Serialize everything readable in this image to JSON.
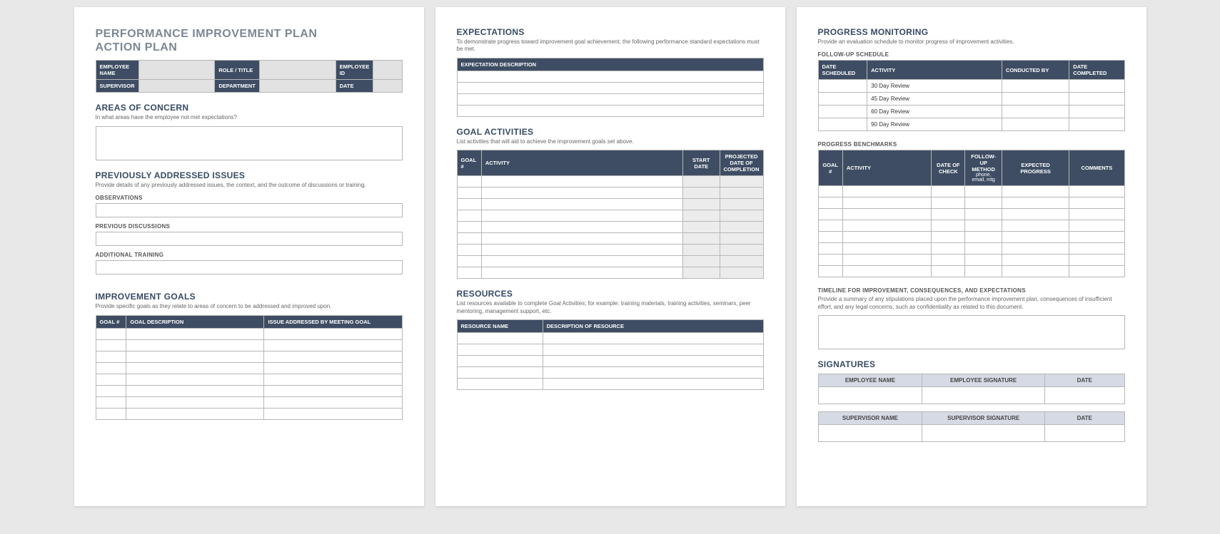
{
  "page1": {
    "title_line1": "PERFORMANCE IMPROVEMENT PLAN",
    "title_line2": "ACTION PLAN",
    "info_labels": {
      "employee_name": "EMPLOYEE NAME",
      "role_title": "ROLE / TITLE",
      "employee_id": "EMPLOYEE ID",
      "supervisor": "SUPERVISOR",
      "department": "DEPARTMENT",
      "date": "DATE"
    },
    "areas_of_concern": {
      "heading": "AREAS OF CONCERN",
      "sub": "In what areas have the employee not met expectations?"
    },
    "previously_addressed": {
      "heading": "PREVIOUSLY ADDRESSED ISSUES",
      "sub": "Provide details of any previously addressed issues, the context, and the outcome of discussions or training.",
      "observations": "OBSERVATIONS",
      "previous_discussions": "PREVIOUS DISCUSSIONS",
      "additional_training": "ADDITIONAL TRAINING"
    },
    "improvement_goals": {
      "heading": "IMPROVEMENT GOALS",
      "sub": "Provide specific goals as they relate to areas of concern to be addressed and improved upon.",
      "cols": {
        "goal_num": "GOAL #",
        "goal_desc": "GOAL DESCRIPTION",
        "issue": "ISSUE ADDRESSED BY MEETING GOAL"
      }
    }
  },
  "page2": {
    "expectations": {
      "heading": "EXPECTATIONS",
      "sub": "To demonstrate progress toward improvement goal achievement, the following performance standard expectations must be met.",
      "col": "EXPECTATION DESCRIPTION"
    },
    "goal_activities": {
      "heading": "GOAL ACTIVITIES",
      "sub": "List activities that will aid to achieve the improvement goals set above.",
      "cols": {
        "goal_num": "GOAL #",
        "activity": "ACTIVITY",
        "start": "START DATE",
        "projected": "PROJECTED DATE OF COMPLETION"
      }
    },
    "resources": {
      "heading": "RESOURCES",
      "sub": "List resources available to complete Goal Activities; for example: training materials, training activities, seminars, peer mentoring, management support, etc.",
      "cols": {
        "name": "RESOURCE NAME",
        "desc": "DESCRIPTION OF RESOURCE"
      }
    }
  },
  "page3": {
    "progress_monitoring": {
      "heading": "PROGRESS MONITORING",
      "sub": "Provide an evaluation schedule to monitor progress of improvement activities."
    },
    "followup": {
      "label": "FOLLOW-UP SCHEDULE",
      "cols": {
        "date_scheduled": "DATE SCHEDULED",
        "activity": "ACTIVITY",
        "conducted_by": "CONDUCTED BY",
        "date_completed": "DATE COMPLETED"
      },
      "rows": [
        "30 Day Review",
        "45 Day Review",
        "60 Day Review",
        "90 Day Review"
      ]
    },
    "benchmarks": {
      "label": "PROGRESS BENCHMARKS",
      "cols": {
        "goal_num": "GOAL #",
        "activity": "ACTIVITY",
        "date_of_check": "DATE OF CHECK",
        "followup_method": "FOLLOW-UP METHOD",
        "followup_method_sub": "phone, email, mtg",
        "expected_progress": "EXPECTED PROGRESS",
        "comments": "COMMENTS"
      }
    },
    "timeline": {
      "label": "TIMELINE FOR IMPROVEMENT, CONSEQUENCES, AND EXPECTATIONS",
      "sub": "Provide a summary of any stipulations placed upon the performance improvement plan, consequences of insufficient effort, and any legal concerns, such as confidentiality as related to this document."
    },
    "signatures": {
      "heading": "SIGNATURES",
      "emp": {
        "name": "EMPLOYEE NAME",
        "sig": "EMPLOYEE SIGNATURE",
        "date": "DATE"
      },
      "sup": {
        "name": "SUPERVISOR NAME",
        "sig": "SUPERVISOR SIGNATURE",
        "date": "DATE"
      }
    }
  }
}
